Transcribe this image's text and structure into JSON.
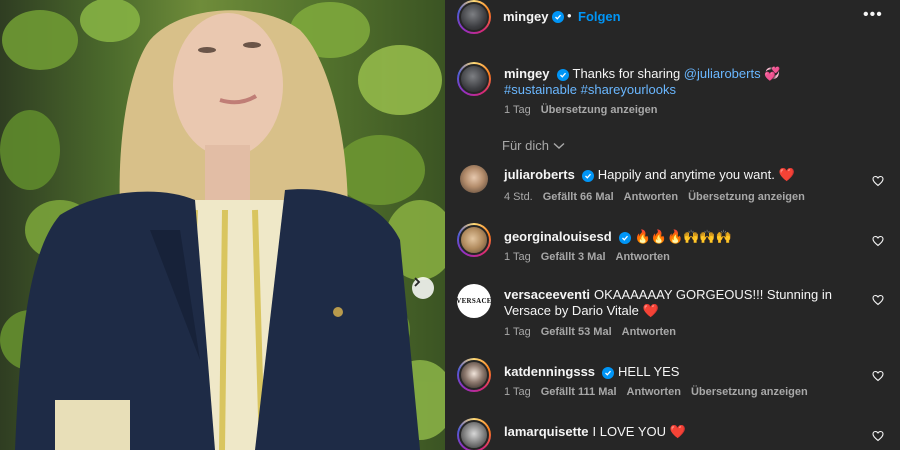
{
  "post": {
    "author": "mingey",
    "separator": "•",
    "follow_label": "Folgen",
    "more_label": "•••"
  },
  "caption": {
    "author": "mingey",
    "text_before": "Thanks for sharing ",
    "mention": "@juliaroberts",
    "emoji": "💞",
    "hashtags": "#sustainable #shareyourlooks",
    "time": "1 Tag",
    "translate": "Übersetzung anzeigen"
  },
  "filter": {
    "label": "Für dich"
  },
  "comments": [
    {
      "user": "juliaroberts",
      "text": "Happily and anytime you want. ❤️",
      "time": "4 Std.",
      "likes": "Gefällt 66 Mal",
      "reply": "Antworten",
      "translate": "Übersetzung anzeigen"
    },
    {
      "user": "georginalouisesd",
      "text": "🔥🔥🔥🙌🙌🙌",
      "time": "1 Tag",
      "likes": "Gefällt 3 Mal",
      "reply": "Antworten"
    },
    {
      "user": "versaceeventi",
      "text": "OKAAAAAAY GORGEOUS!!! Stunning in Versace by Dario Vitale ❤️",
      "time": "1 Tag",
      "likes": "Gefällt 53 Mal",
      "reply": "Antworten",
      "avatar_text": "VERSACE"
    },
    {
      "user": "katdenningsss",
      "text": "HELL YES",
      "time": "1 Tag",
      "likes": "Gefällt 111 Mal",
      "reply": "Antworten",
      "translate": "Übersetzung anzeigen"
    },
    {
      "user": "lamarquisette",
      "text": "I LOVE YOU ❤️"
    }
  ],
  "colors": {
    "panel_bg": "#262626",
    "link_blue": "#0095f6",
    "hashtag_blue": "#6ab7ff",
    "muted": "#a8a8a8"
  }
}
